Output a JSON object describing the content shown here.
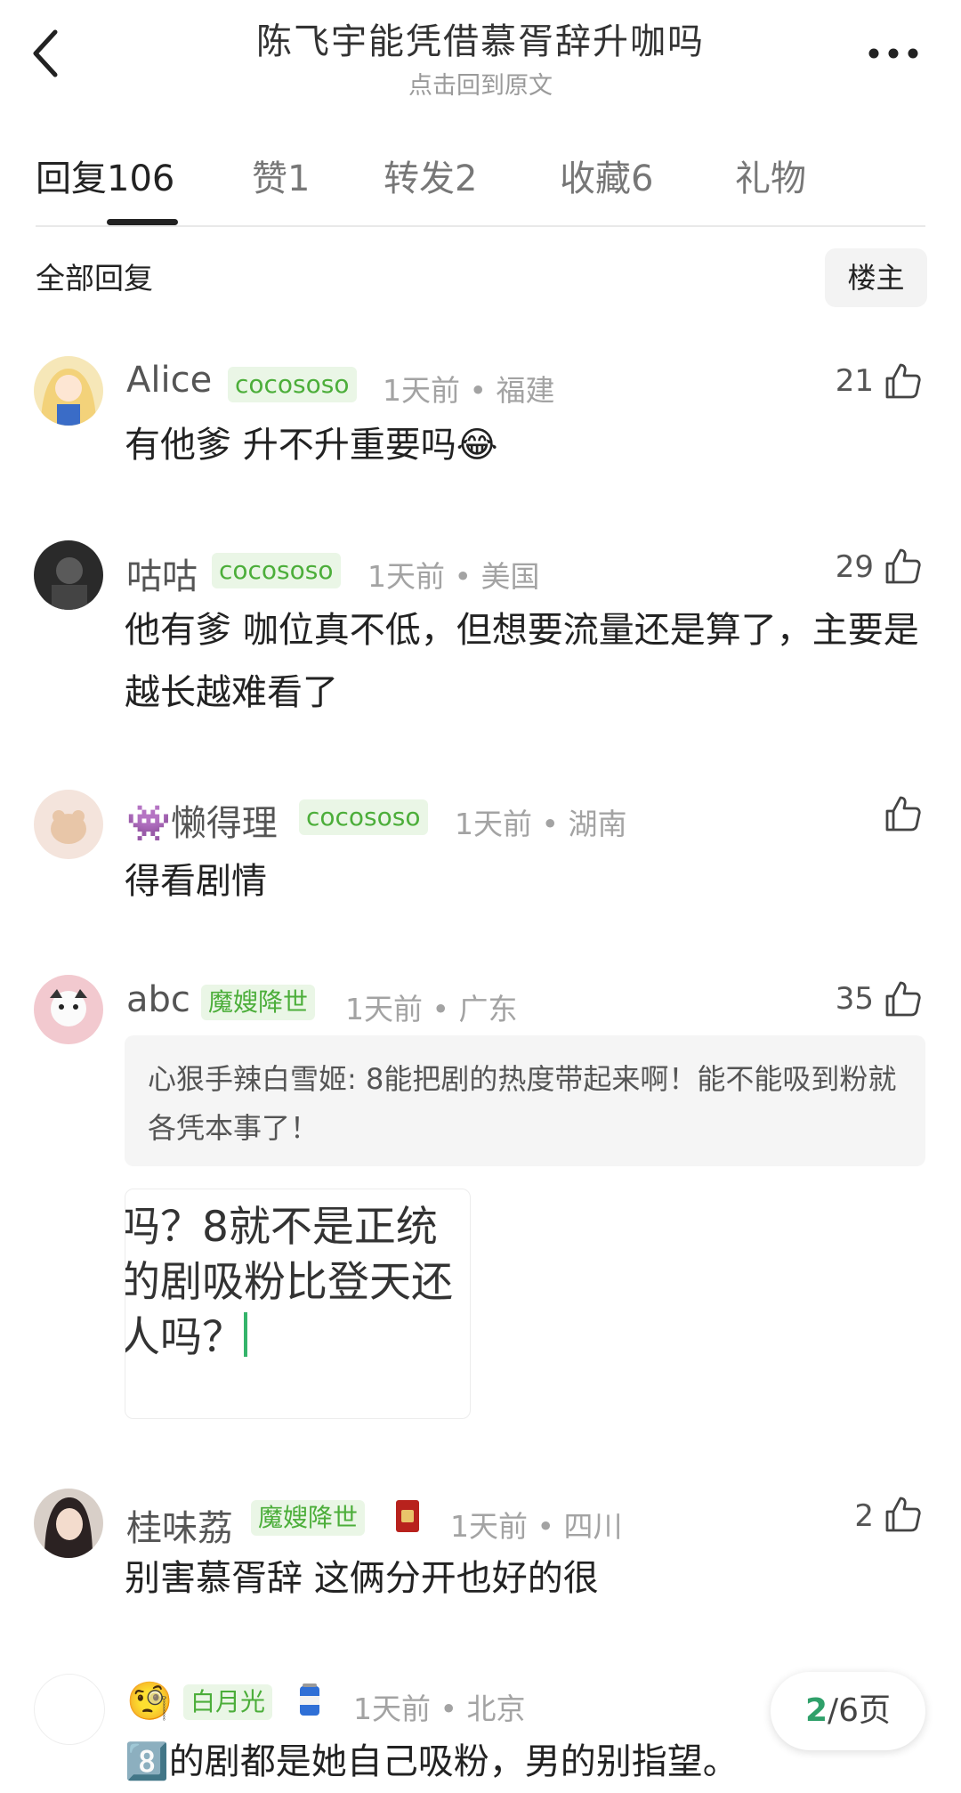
{
  "header": {
    "title": "陈飞宇能凭借慕胥辞升咖吗",
    "subtitle": "点击回到原文"
  },
  "tabs": [
    {
      "label": "回复",
      "count": "106"
    },
    {
      "label": "赞",
      "count": "1"
    },
    {
      "label": "转发",
      "count": "2"
    },
    {
      "label": "收藏",
      "count": "6"
    },
    {
      "label": "礼物",
      "count": ""
    }
  ],
  "filter": {
    "label": "全部回复",
    "op_label": "楼主"
  },
  "comments": [
    {
      "username": "Alice",
      "badge": "cocososo",
      "time": "1天前",
      "location": "福建",
      "likes": "21",
      "text": "有他爹 升不升重要吗😂"
    },
    {
      "username": "咕咕",
      "badge": "cocososo",
      "time": "1天前",
      "location": "美国",
      "likes": "29",
      "text": "他有爹 咖位真不低，但想要流量还是算了，主要是越长越难看了"
    },
    {
      "username": "懒得理",
      "username_prefix": "👾",
      "badge": "cocososo",
      "time": "1天前",
      "location": "湖南",
      "likes": "",
      "text": "得看剧情"
    },
    {
      "username": "abc",
      "badge": "魔嫂降世",
      "time": "1天前",
      "location": "广东",
      "likes": "35",
      "quote": "心狠手辣白雪姬: 8能把剧的热度带起来啊！能不能吸到粉就各凭本事了！",
      "image_lines": [
        "吗？8就不是正统",
        "的剧吸粉比登天还",
        "人吗？"
      ]
    },
    {
      "username": "桂味荔",
      "badge": "魔嫂降世",
      "badge_icon": "red-card-icon",
      "time": "1天前",
      "location": "四川",
      "likes": "2",
      "text": "别害慕胥辞  这俩分开也好的很"
    },
    {
      "username_emoji": "🧐",
      "badge": "白月光",
      "badge_icon": "can-icon",
      "time": "1天前",
      "location": "北京",
      "likes": "",
      "text": "8️⃣的剧都是她自己吸粉，男的别指望。"
    }
  ],
  "pager": {
    "current": "2",
    "total": "6页"
  },
  "colors": {
    "accent_green": "#4cae3a",
    "badge_bg": "#eaf6e6",
    "pager_green": "#2fa06a"
  }
}
